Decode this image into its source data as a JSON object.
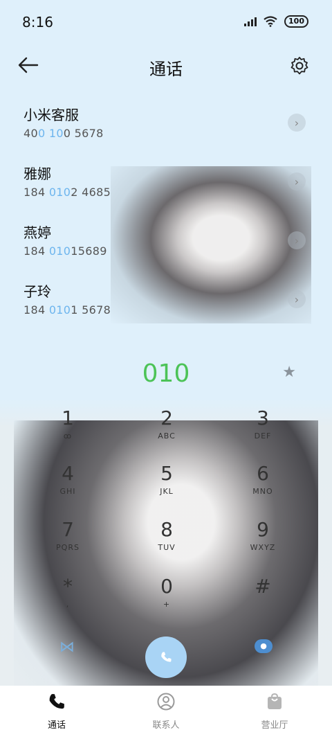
{
  "status_bar": {
    "time": "8:16",
    "battery": "100"
  },
  "header": {
    "title": "通话"
  },
  "recent_calls": [
    {
      "name": "小米客服",
      "num_pre": "40",
      "num_hl": "0 10",
      "num_post": "0 5678"
    },
    {
      "name": "雅娜",
      "num_pre": "184 ",
      "num_hl": "010",
      "num_post": "2 4685"
    },
    {
      "name": "燕婷",
      "num_pre": "184 ",
      "num_hl": "010",
      "num_post": "15689"
    },
    {
      "name": "子玲",
      "num_pre": "184 ",
      "num_hl": "010",
      "num_post": "1 5678"
    }
  ],
  "dialer": {
    "input": "010",
    "keys": [
      {
        "d": "1",
        "l": "ꝏ"
      },
      {
        "d": "2",
        "l": "ABC"
      },
      {
        "d": "3",
        "l": "DEF"
      },
      {
        "d": "4",
        "l": "GHI"
      },
      {
        "d": "5",
        "l": "JKL"
      },
      {
        "d": "6",
        "l": "MNO"
      },
      {
        "d": "7",
        "l": "PQRS"
      },
      {
        "d": "8",
        "l": "TUV"
      },
      {
        "d": "9",
        "l": "WXYZ"
      },
      {
        "d": "*",
        "l": ","
      },
      {
        "d": "0",
        "l": "+"
      },
      {
        "d": "#",
        "l": ""
      }
    ]
  },
  "nav": {
    "tabs": [
      {
        "label": "通话",
        "icon": "phone-icon",
        "active": true
      },
      {
        "label": "联系人",
        "icon": "person-icon",
        "active": false
      },
      {
        "label": "营业厅",
        "icon": "bag-icon",
        "active": false
      }
    ]
  },
  "colors": {
    "accent_green": "#4cc357",
    "highlight_blue": "#6db5ee"
  }
}
